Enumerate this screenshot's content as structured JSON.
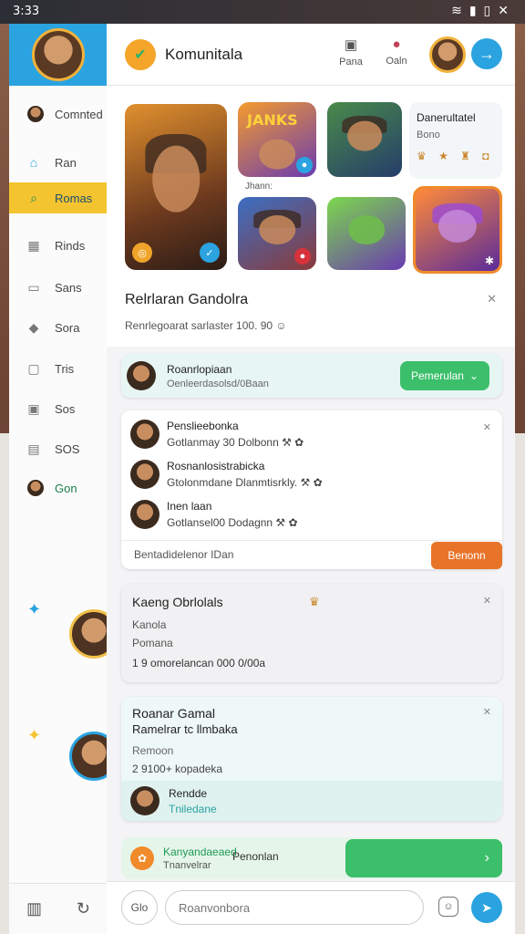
{
  "status_bar": {
    "time": "3:33",
    "icons": [
      "wifi-icon",
      "signal-icon",
      "battery-icon",
      "close-icon"
    ]
  },
  "sidebar": {
    "items": [
      {
        "label": "Comnted",
        "icon": "avatar"
      },
      {
        "label": "Ran",
        "icon": "home-icon"
      },
      {
        "label": "Romas",
        "icon": "search-icon",
        "active": true
      },
      {
        "label": "Rinds",
        "icon": "grid-icon"
      },
      {
        "label": "Sans",
        "icon": "folder-icon"
      },
      {
        "label": "Sora",
        "icon": "tag-icon"
      },
      {
        "label": "Tris",
        "icon": "calendar-icon"
      },
      {
        "label": "Sos",
        "icon": "box-icon"
      },
      {
        "label": "SOS",
        "icon": "doc-icon"
      },
      {
        "label": "Gon",
        "icon": "avatar"
      }
    ]
  },
  "header": {
    "title": "Komunitala",
    "btn1_label": "Pana",
    "btn2_label": "Oaln"
  },
  "gallery": {
    "tile_caption": "Jhann:",
    "tile_a_text": "JANKS",
    "info_title": "Danerultatel",
    "info_sub": "Bono",
    "info_icons": "♛ ★ ♜ ◘"
  },
  "section": {
    "title": "Relrlaran Gandolra",
    "subtitle": "Renrlegoarat sarlaster 100. 90 ☺"
  },
  "request": {
    "name": "Roanrlopiaan",
    "desc": "Oenleerdasolsd/0Baan",
    "button": "Pemerulan"
  },
  "friends": {
    "rows": [
      {
        "name": "Penslieebonka",
        "desc": "Gotlanmay 30 Dolbonn ⚒ ✿"
      },
      {
        "name": "Rosnanlosistrabicka",
        "desc": "Gtolonmdane Dlanmtisrkly. ⚒ ✿"
      },
      {
        "name": "Inen laan",
        "desc": "Gotlansel00 Dodagnn ⚒ ✿"
      }
    ],
    "footer": "Bentadidelenor IDan",
    "button": "Benonn"
  },
  "groups": {
    "title": "Kaeng Obrlolals",
    "line1": "Kanola",
    "line2": "Pomana",
    "line3": "1 9 omorelancan 000 0/00a"
  },
  "reward": {
    "title": "Roanar Gamal",
    "title2": "Ramelrar tc llmbaka",
    "line1": "Remoon",
    "line2": "2 9100+ kopadeka",
    "member_name": "Rendde",
    "member_desc": "Tniledane"
  },
  "promo": {
    "title": "Kanyandaeaed",
    "sub": "Tnanvelrar",
    "middle": "Penonlan"
  },
  "input": {
    "left_label": "Glo",
    "placeholder": "Roanvonbora"
  },
  "colors": {
    "accent": "#2aa3e0",
    "active": "#f4c430",
    "green": "#3cbf6b",
    "orange": "#e8742a"
  }
}
